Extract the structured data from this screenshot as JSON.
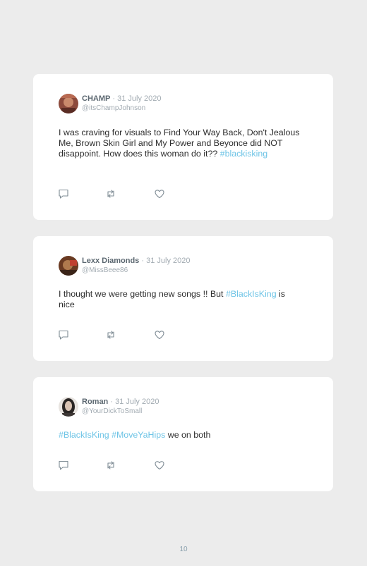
{
  "tweets": [
    {
      "name": "CHAMP",
      "date": "· 31 July 2020",
      "handle": "@itsChampJohnson",
      "text_parts": [
        "I was craving for visuals to Find Your Way Back, Don't Jealous Me, Brown Skin Girl and My Power and Beyonce did NOT disappoint. How does this woman do it?? ",
        "#blackisking"
      ]
    },
    {
      "name": "Lexx Diamonds",
      "date": "· 31 July 2020",
      "handle": "@MissBeee86",
      "text_parts": [
        "I thought we were getting new songs !! But ",
        "#BlackIsKing",
        " is nice"
      ]
    },
    {
      "name": "Roman",
      "date": "· 31 July 2020",
      "handle": "@YourDickToSmall",
      "text_parts": [
        "#BlackIsKing",
        " ",
        "#MoveYaHips",
        " we on both"
      ]
    }
  ],
  "icons": [
    "reply-icon",
    "retweet-icon",
    "like-icon"
  ],
  "colors": {
    "hashtag": "#6ec4e6",
    "background": "#ececec",
    "card": "#ffffff"
  },
  "page_number": "10"
}
